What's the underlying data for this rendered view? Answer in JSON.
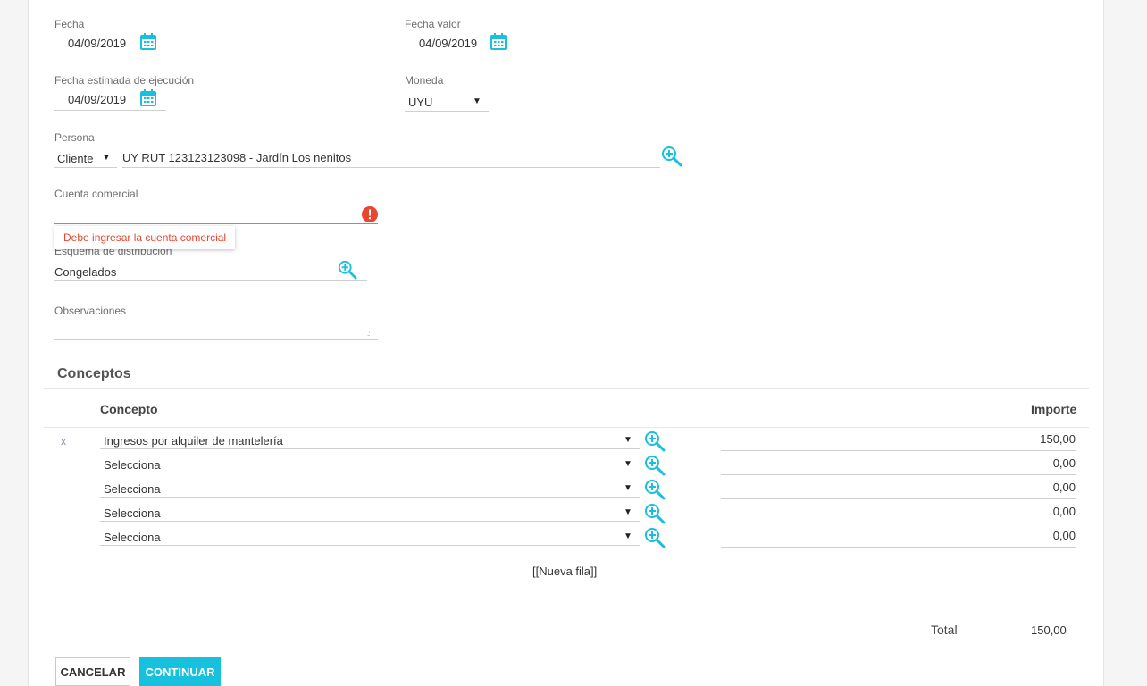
{
  "form": {
    "fecha": {
      "label": "Fecha",
      "value": "04/09/2019"
    },
    "fecha_valor": {
      "label": "Fecha valor",
      "value": "04/09/2019"
    },
    "fecha_estimada": {
      "label": "Fecha estimada de ejecución",
      "value": "04/09/2019"
    },
    "moneda": {
      "label": "Moneda",
      "value": "UYU"
    },
    "persona": {
      "label": "Persona",
      "type_value": "Cliente",
      "value": "UY RUT 123123123098 - Jardín Los nenitos"
    },
    "cuenta_comercial": {
      "label": "Cuenta comercial",
      "value": "",
      "error": "Debe ingresar la cuenta comercial"
    },
    "esquema": {
      "label": "Esquema de distribución",
      "value": "Congelados"
    },
    "observaciones": {
      "label": "Observaciones",
      "value": ""
    }
  },
  "conceptos": {
    "title": "Conceptos",
    "col_concepto": "Concepto",
    "col_importe": "Importe",
    "remove_symbol": "x",
    "rows": [
      {
        "concepto": "Ingresos por alquiler de mantelería",
        "importe": "150,00"
      },
      {
        "concepto": "Selecciona",
        "importe": "0,00"
      },
      {
        "concepto": "Selecciona",
        "importe": "0,00"
      },
      {
        "concepto": "Selecciona",
        "importe": "0,00"
      },
      {
        "concepto": "Selecciona",
        "importe": "0,00"
      }
    ],
    "new_row_label": "[[Nueva fila]]",
    "total_label": "Total",
    "total_value": "150,00"
  },
  "actions": {
    "cancel_label": "CANCELAR",
    "continue_label": "CONTINUAR"
  },
  "colors": {
    "accent": "#17c0dc",
    "error": "#e8462e"
  },
  "icons": {
    "calendar": "calendar-icon",
    "search": "zoom-in-icon",
    "error": "error-icon",
    "dropdown": "caret-down-icon"
  }
}
